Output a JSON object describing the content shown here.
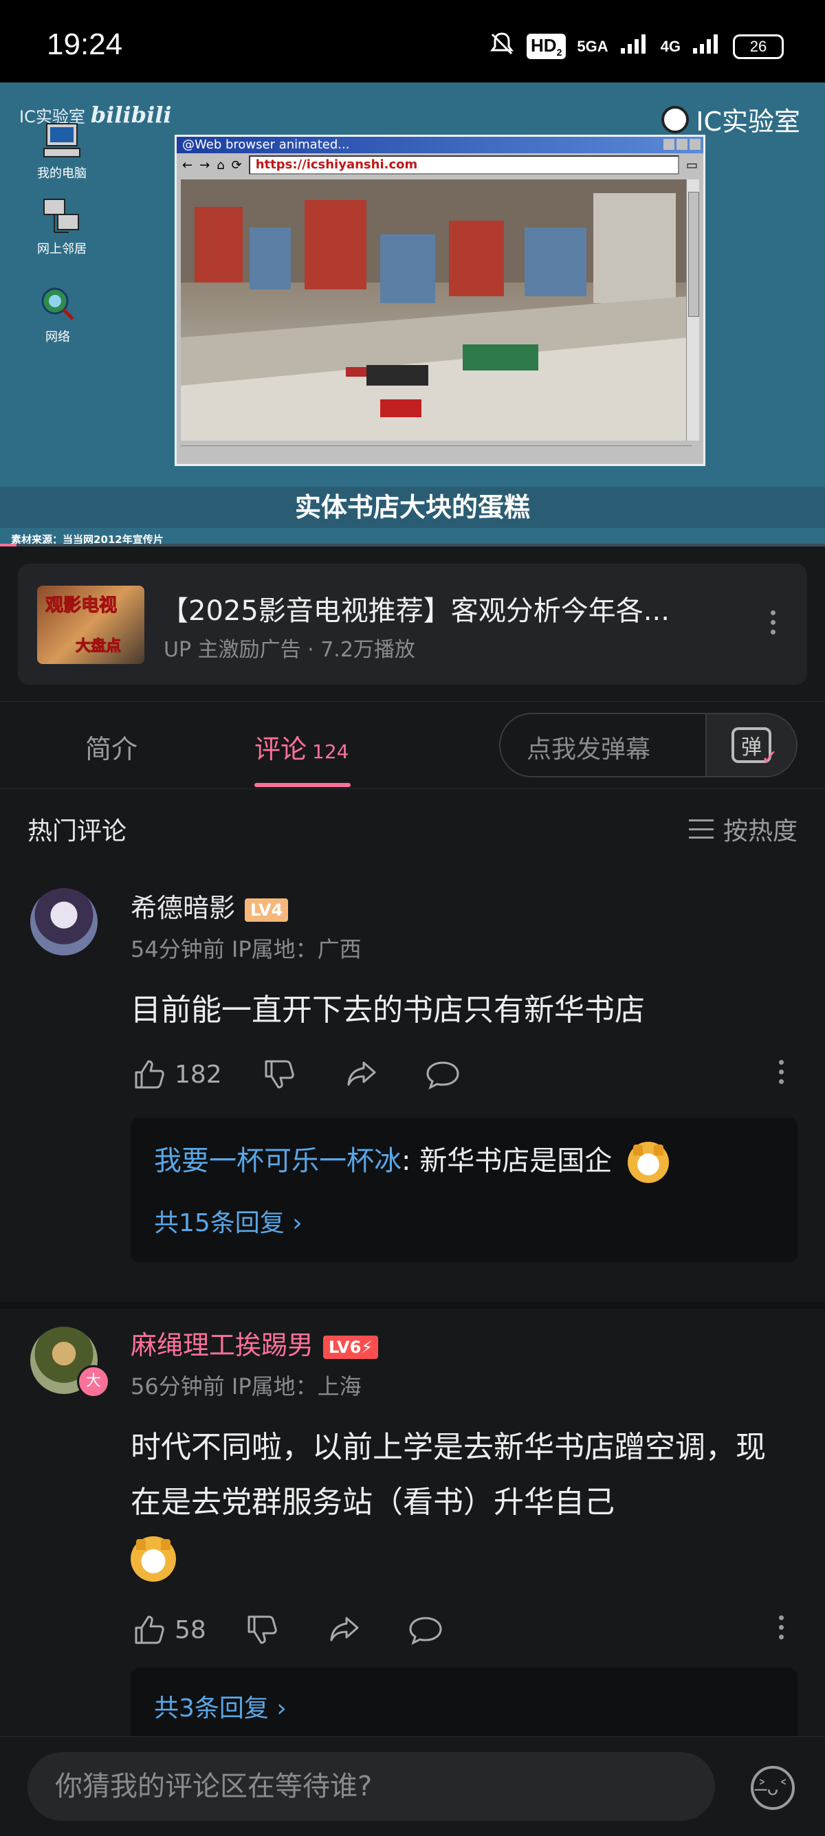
{
  "status_bar": {
    "time": "19:24",
    "hd_label": "HD",
    "hd_sub": "2",
    "net1": "5GA",
    "net2": "4G",
    "battery": "26"
  },
  "video": {
    "watermark_left": "IC实验室",
    "watermark_brand": "bilibili",
    "watermark_right": "IC实验室",
    "desktop_icons": [
      "我的电脑",
      "网上邻居",
      "网络"
    ],
    "browser_title": "@Web browser animated...",
    "browser_url": "https://icshiyanshi.com",
    "subtitle": "实体书店大块的蛋糕",
    "source_note": "素材来源：当当网2012年宣传片",
    "progress": 0.02
  },
  "ad": {
    "thumb_text_1": "观影电视",
    "thumb_text_2": "大盘点",
    "title": "【2025影音电视推荐】客观分析今年各...",
    "meta": "UP 主激励广告 · 7.2万播放"
  },
  "tabs": {
    "intro": "简介",
    "comments": "评论",
    "comments_count": "124",
    "danmu_placeholder": "点我发弹幕",
    "danmu_button": "弹"
  },
  "comments_header": {
    "title": "热门评论",
    "sort": "按热度"
  },
  "comments": [
    {
      "user": "希德暗影",
      "level": "LV4",
      "meta": "54分钟前 IP属地：广西",
      "text": "目前能一直开下去的书店只有新华书店",
      "likes": "182",
      "reply_user": "我要一杯可乐一杯冰",
      "reply_text": ": 新华书店是国企",
      "reply_count": "共15条回复 ›"
    },
    {
      "user": "麻绳理工挨踢男",
      "level": "LV6⚡",
      "avatar_badge": "大",
      "meta": "56分钟前 IP属地：上海",
      "text": "时代不同啦，以前上学是去新华书店蹭空调，现在是去党群服务站（看书）升华自己",
      "likes": "58",
      "reply_count": "共3条回复 ›"
    }
  ],
  "input": {
    "placeholder": "你猜我的评论区在等待谁?"
  },
  "colors": {
    "accent": "#fb7299",
    "reply_link": "#5aa6e6",
    "background": "#17181a"
  }
}
